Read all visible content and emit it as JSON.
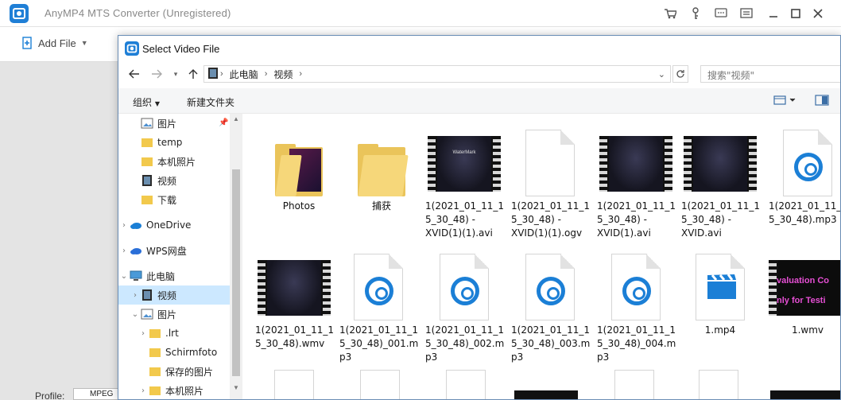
{
  "app": {
    "title": "AnyMP4 MTS Converter (Unregistered)",
    "toolbar": {
      "add_file": "Add File"
    },
    "profile_label": "Profile:",
    "profile_value": "MPEG"
  },
  "dialog": {
    "title": "Select Video File",
    "breadcrumb": [
      "此电脑",
      "视频"
    ],
    "search_placeholder": "搜索\"视频\"",
    "organize": "组织",
    "new_folder": "新建文件夹",
    "nav": [
      {
        "label": "图片",
        "icon": "pictures-icon",
        "pinned": true
      },
      {
        "label": "temp",
        "icon": "folder-icon"
      },
      {
        "label": "本机照片",
        "icon": "folder-icon"
      },
      {
        "label": "视频",
        "icon": "videos-icon"
      },
      {
        "label": "下载",
        "icon": "folder-icon"
      },
      {
        "label": "OneDrive",
        "icon": "cloud-icon"
      },
      {
        "label": "WPS网盘",
        "icon": "cloud-icon"
      },
      {
        "label": "此电脑",
        "icon": "computer-icon"
      },
      {
        "label": "视频",
        "icon": "videos-icon",
        "selected": true
      },
      {
        "label": "图片",
        "icon": "pictures-icon"
      },
      {
        "label": ".lrt",
        "icon": "folder-icon"
      },
      {
        "label": "Schirmfoto",
        "icon": "folder-icon"
      },
      {
        "label": "保存的图片",
        "icon": "folder-icon"
      },
      {
        "label": "本机照片",
        "icon": "folder-icon"
      }
    ],
    "files": [
      {
        "name": "Photos",
        "kind": "folder-photos"
      },
      {
        "name": "捕获",
        "kind": "folder"
      },
      {
        "name": "1(2021_01_11_1\n5_30_48) -\nXVID(1)(1).avi",
        "kind": "video"
      },
      {
        "name": "1(2021_01_11_1\n5_30_48) -\nXVID(1)(1).ogv",
        "kind": "blank"
      },
      {
        "name": "1(2021_01_11_1\n5_30_48) -\nXVID(1).avi",
        "kind": "video"
      },
      {
        "name": "1(2021_01_11_1\n5_30_48) -\nXVID.avi",
        "kind": "video"
      },
      {
        "name": "1(2021_01_11_1\n5_30_48).mp3",
        "kind": "audio"
      },
      {
        "name": "1(2021_01_11_1\n5_30_48).wmv",
        "kind": "video"
      },
      {
        "name": "1(2021_01_11_1\n5_30_48)_001.m\np3",
        "kind": "audio"
      },
      {
        "name": "1(2021_01_11_1\n5_30_48)_002.m\np3",
        "kind": "audio"
      },
      {
        "name": "1(2021_01_11_1\n5_30_48)_003.m\np3",
        "kind": "audio"
      },
      {
        "name": "1(2021_01_11_1\n5_30_48)_004.m\np3",
        "kind": "audio"
      },
      {
        "name": "1.mp4",
        "kind": "clapper"
      },
      {
        "name": "1.wmv",
        "kind": "video-eval"
      }
    ],
    "video_watermark_text": "WaterMark",
    "eval_text": [
      "valuation Co",
      "nly for Testi"
    ]
  }
}
